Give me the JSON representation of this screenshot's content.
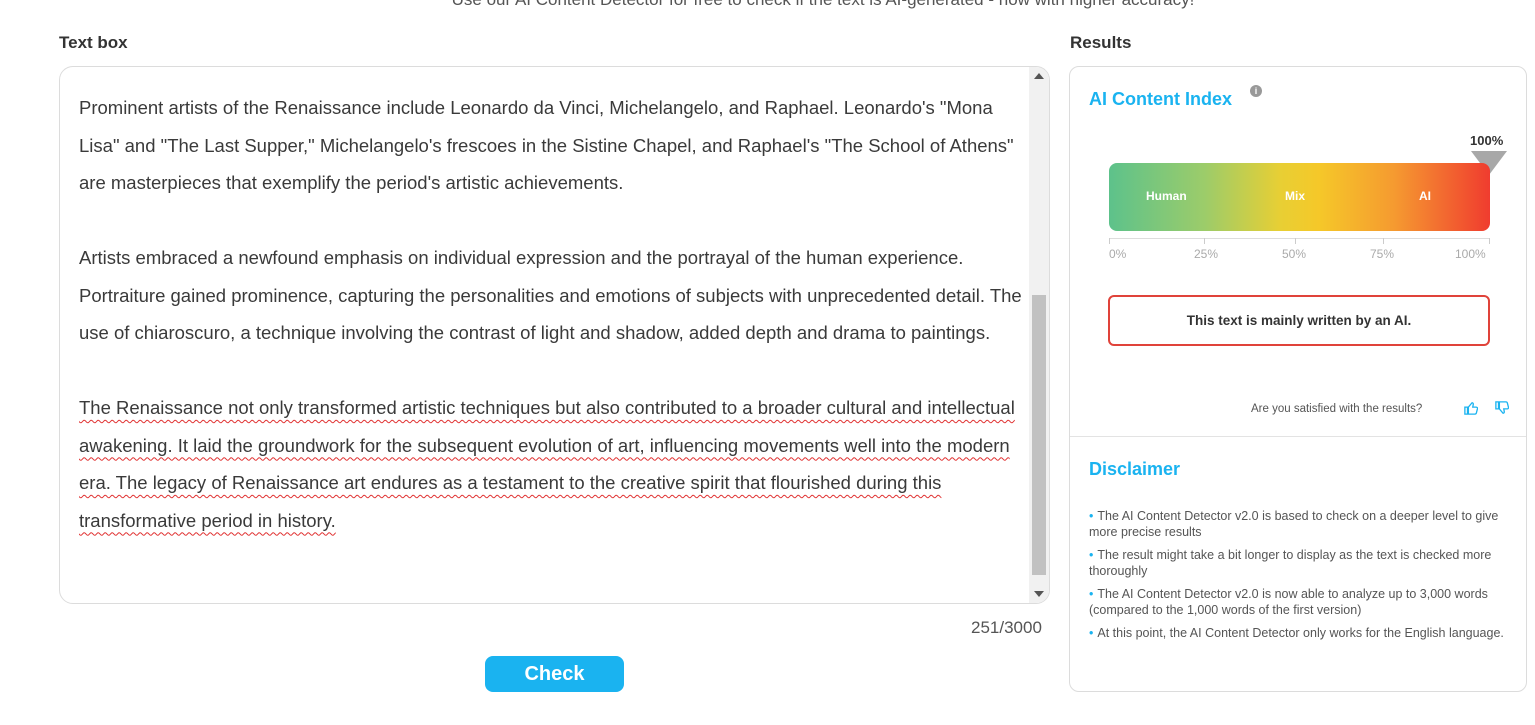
{
  "header": {
    "subtitle": "Use our AI Content Detector for free to check if the text is AI-generated - now with higher accuracy!"
  },
  "textbox": {
    "label": "Text box",
    "paragraphs": [
      "Prominent artists of the Renaissance include Leonardo da Vinci, Michelangelo, and Raphael. Leonardo's \"Mona Lisa\" and \"The Last Supper,\" Michelangelo's frescoes in the Sistine Chapel, and Raphael's \"The School of Athens\" are masterpieces that exemplify the period's artistic achievements.",
      "Artists embraced a newfound emphasis on individual expression and the portrayal of the human experience. Portraiture gained prominence, capturing the personalities and emotions of subjects with unprecedented detail. The use of chiaroscuro, a technique involving the contrast of light and shadow, added depth and drama to paintings.",
      "The Renaissance not only transformed artistic techniques but also contributed to a broader cultural and intellectual awakening. It laid the groundwork for the subsequent evolution of art, influencing movements well into the modern era. The legacy of Renaissance art endures as a testament to the creative spirit that flourished during this transformative period in history."
    ],
    "word_count": "251/3000",
    "check_label": "Check"
  },
  "results": {
    "label": "Results",
    "ai_index_title": "AI Content Index",
    "info_glyph": "i",
    "ai_percent_label": "100%",
    "ai_score": 1.0,
    "gauge_labels": {
      "human": "Human",
      "mix": "Mix",
      "ai": "AI"
    },
    "scale": [
      "0%",
      "25%",
      "50%",
      "75%",
      "100%"
    ],
    "verdict": "This text is mainly written by an AI.",
    "satisfied_question": "Are you satisfied with the results?",
    "icons": {
      "thumbs_up": "thumbs-up-icon",
      "thumbs_down": "thumbs-down-icon",
      "info": "info-icon"
    },
    "colors": {
      "accent": "#1ab3f0",
      "verdict_border": "#e0433a"
    }
  },
  "disclaimer": {
    "title": "Disclaimer",
    "items": [
      "The AI Content Detector v2.0 is based to check on a deeper level to give more precise results",
      "The result might take a bit longer to display as the text is checked more thoroughly",
      "The AI Content Detector v2.0 is now able to analyze up to 3,000 words (compared to the 1,000 words of the first version)",
      "At this point, the AI Content Detector only works for the English language."
    ]
  }
}
